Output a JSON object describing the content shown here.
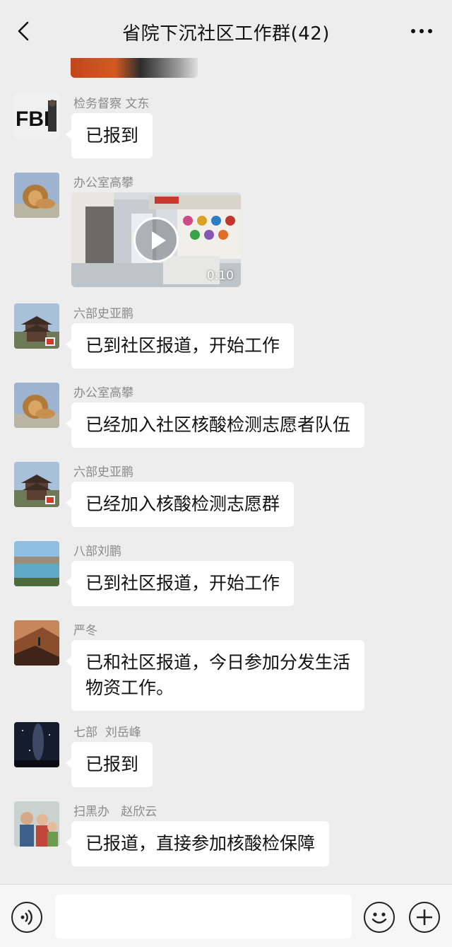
{
  "header": {
    "title": "省院下沉社区工作群(42)",
    "back_icon": "chevron-left-icon",
    "more_icon": "more-dots-icon"
  },
  "messages": [
    {
      "sender": "检务督察 文东",
      "text": "已报到",
      "avatar": "fbi-avatar"
    },
    {
      "sender": "办公室高攀",
      "type": "video",
      "duration": "0:10",
      "avatar": "lion-avatar"
    },
    {
      "sender": "六部史亚鹏",
      "text": "已到社区报道，开始工作",
      "avatar": "pagoda-avatar"
    },
    {
      "sender": "办公室高攀",
      "text": "已经加入社区核酸检测志愿者队伍",
      "avatar": "lion-avatar"
    },
    {
      "sender": "六部史亚鹏",
      "text": "已经加入核酸检测志愿群",
      "avatar": "pagoda-avatar"
    },
    {
      "sender": "八部刘鹏",
      "text": "已到社区报道，开始工作",
      "avatar": "lake-avatar"
    },
    {
      "sender": "严冬",
      "text_line1": "已和社区报道，今日参加分发生活",
      "text_line2": "物资工作。",
      "avatar": "desert-avatar"
    },
    {
      "sender": "七部  刘岳峰",
      "text": "已报到",
      "avatar": "night-sky-avatar"
    },
    {
      "sender": "扫黑办   赵欣云",
      "text": "已报道，直接参加核酸检保障",
      "avatar": "family-avatar"
    }
  ],
  "input_bar": {
    "voice_icon": "voice-icon",
    "emoji_icon": "emoji-icon",
    "plus_icon": "plus-icon",
    "input_value": ""
  },
  "colors": {
    "background": "#ededed",
    "bubble": "#ffffff",
    "sender_text": "#8a8a8a"
  }
}
